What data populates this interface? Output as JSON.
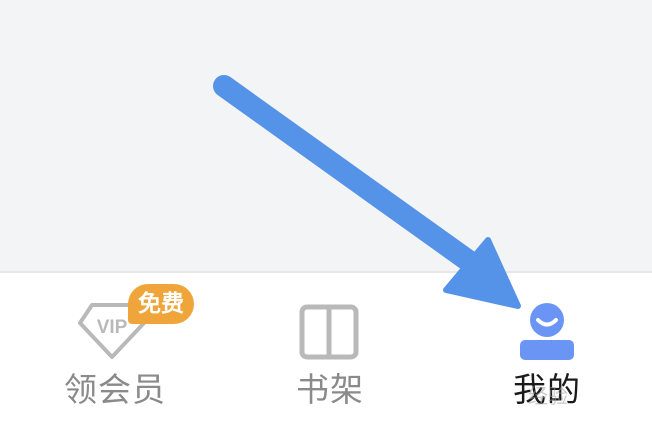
{
  "tabbar": {
    "items": [
      {
        "label": "领会员",
        "badge": "免费",
        "icon": "vip-diamond-icon",
        "icon_text": "VIP",
        "active": false
      },
      {
        "label": "书架",
        "icon": "book-open-icon",
        "active": false
      },
      {
        "label": "我的",
        "icon": "user-profile-icon",
        "active": true
      }
    ]
  },
  "overlay": {
    "arrow": "pointer-arrow-icon",
    "watermark": "经验"
  },
  "colors": {
    "background_top": "#f3f4f6",
    "tab_inactive": "#8a8a8a",
    "tab_active_text": "#1a1a1a",
    "tab_active_icon": "#6b95f5",
    "badge": "#f0a53a",
    "arrow": "#5593e8"
  }
}
